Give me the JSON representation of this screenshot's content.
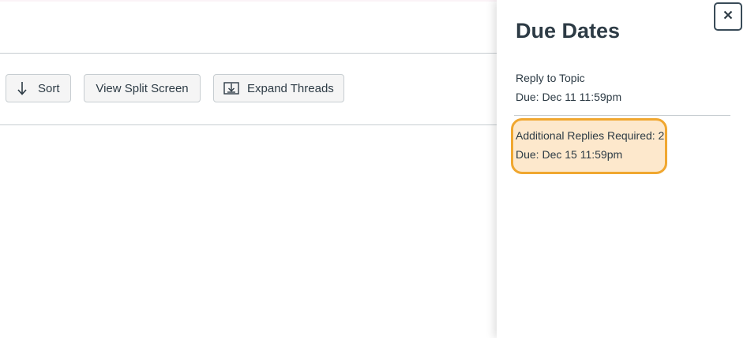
{
  "toolbar": {
    "sort_label": "Sort",
    "split_label": "View Split Screen",
    "expand_label": "Expand Threads"
  },
  "tray": {
    "title": "Due Dates",
    "close_label": "×",
    "items": [
      {
        "label": "Reply to Topic",
        "due": "Due: Dec 11 11:59pm"
      },
      {
        "label": "Additional Replies Required: 2",
        "due": "Due: Dec 15 11:59pm"
      }
    ],
    "highlight_color": "#f0a730"
  },
  "icons": {
    "sort": "arrow-down-icon",
    "expand": "expand-threads-icon",
    "close": "close-icon"
  }
}
